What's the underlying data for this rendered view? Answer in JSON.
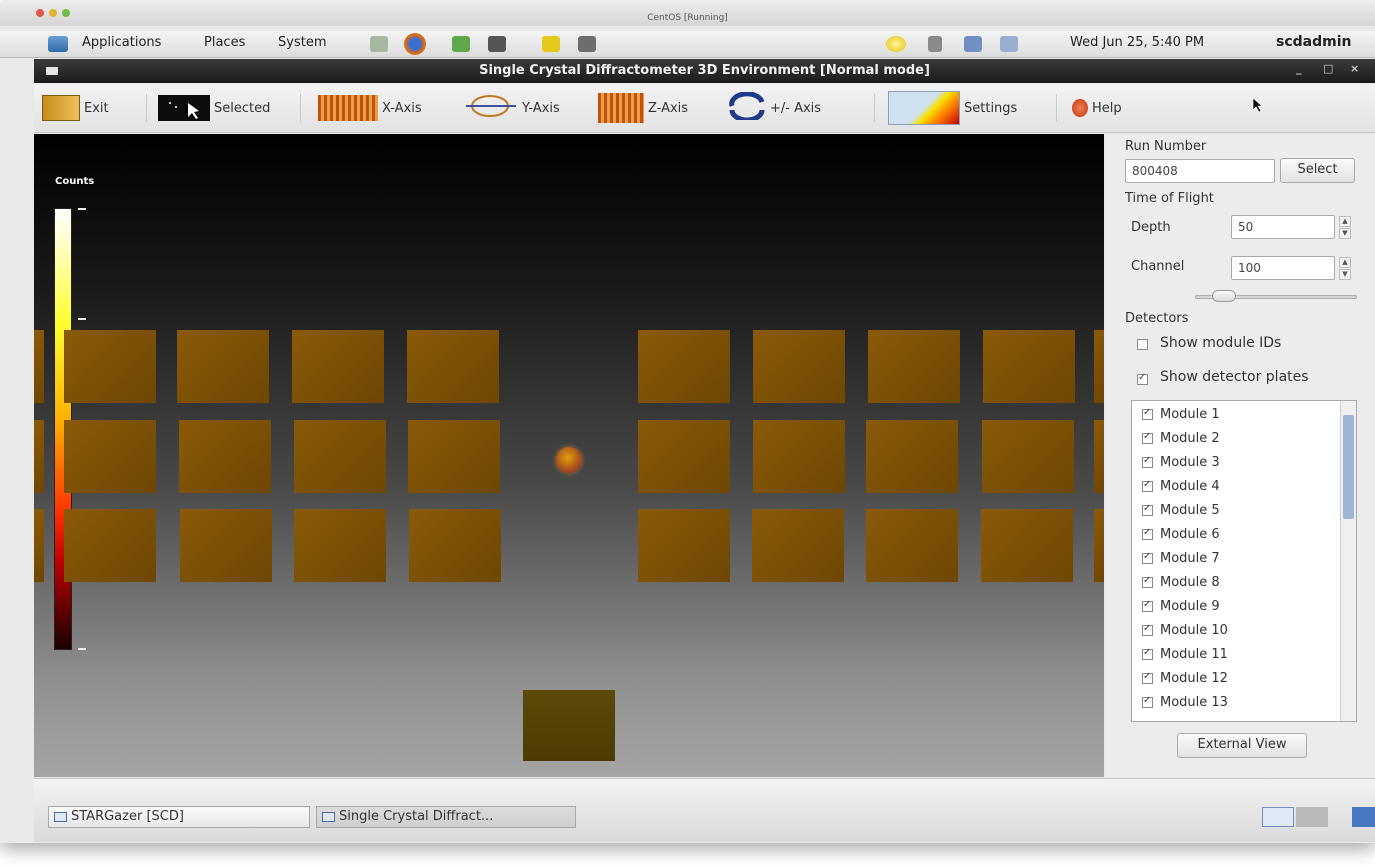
{
  "vm_window": {
    "title": "CentOS [Running]"
  },
  "panel": {
    "menus": [
      "Applications",
      "Places",
      "System"
    ],
    "clock": "Wed Jun 25,  5:40 PM",
    "user": "scdadmin"
  },
  "app": {
    "title": "Single Crystal Diffractometer 3D Environment [Normal mode]",
    "window_controls": [
      "_",
      "□",
      "×"
    ]
  },
  "toolbar": {
    "exit": "Exit",
    "selected": "Selected",
    "x_axis": "X-Axis",
    "y_axis": "Y-Axis",
    "z_axis": "Z-Axis",
    "pm_axis": "+/- Axis",
    "settings": "Settings",
    "help": "Help"
  },
  "viewport": {
    "colorbar_label": "Counts",
    "colors": {
      "plate": "#7c5006",
      "colorbar_top": "#ffffff",
      "colorbar_bottom": "#1a0000"
    }
  },
  "side": {
    "run_number": {
      "title": "Run Number",
      "value": "800408",
      "select_label": "Select"
    },
    "tof": {
      "title": "Time of Flight",
      "depth_label": "Depth",
      "depth_value": "50",
      "channel_label": "Channel",
      "channel_value": "100",
      "channel_slider_fraction": 0.12
    },
    "detectors": {
      "title": "Detectors",
      "show_module_ids": {
        "label": "Show module IDs",
        "checked": false
      },
      "show_detector_plates": {
        "label": "Show detector plates",
        "checked": true
      },
      "modules": [
        "Module 1",
        "Module 2",
        "Module 3",
        "Module 4",
        "Module 5",
        "Module 6",
        "Module 7",
        "Module 8",
        "Module 9",
        "Module 10",
        "Module 11",
        "Module 12",
        "Module 13"
      ],
      "external_view_label": "External View"
    }
  },
  "taskbar": {
    "tasks": [
      "STARGazer [SCD]",
      "Single Crystal Diffract..."
    ]
  }
}
